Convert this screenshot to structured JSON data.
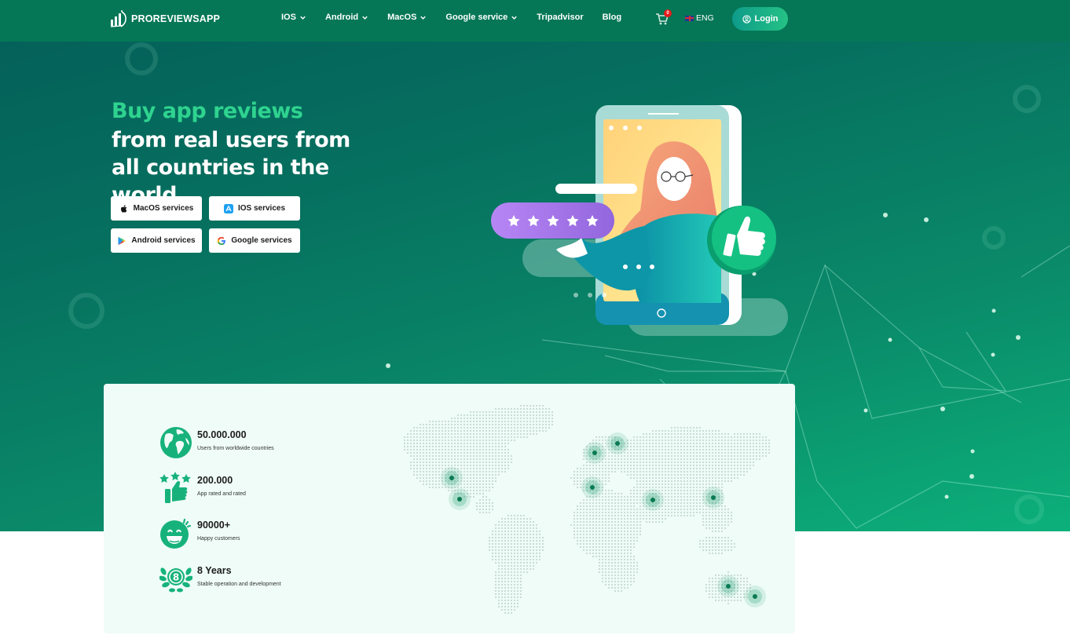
{
  "header": {
    "logo_text": "PROREVIEWSAPP",
    "nav": [
      {
        "label": "IOS",
        "has_dropdown": true
      },
      {
        "label": "Android",
        "has_dropdown": true
      },
      {
        "label": "MacOS",
        "has_dropdown": true
      },
      {
        "label": "Google service",
        "has_dropdown": true
      },
      {
        "label": "Tripadvisor",
        "has_dropdown": false
      },
      {
        "label": "Blog",
        "has_dropdown": false
      }
    ],
    "cart_count": "0",
    "language": "ENG",
    "login_label": "Login"
  },
  "hero": {
    "title_highlight": "Buy app reviews",
    "title_rest": "from real users from all countries in the world",
    "services": [
      {
        "label": "MacOS services",
        "icon": "apple-icon"
      },
      {
        "label": "IOS services",
        "icon": "app-store-icon"
      },
      {
        "label": "Android services",
        "icon": "google-play-icon"
      },
      {
        "label": "Google services",
        "icon": "google-icon"
      }
    ],
    "illustration": {
      "rating_stars": 5
    }
  },
  "stats": [
    {
      "value": "50.000.000",
      "label": "Users from worldwide countries",
      "icon": "globe-icon"
    },
    {
      "value": "200.000",
      "label": "App rated and rated",
      "icon": "stars-thumbs-up-icon"
    },
    {
      "value": "90000+",
      "label": "Happy customers",
      "icon": "happy-face-icon"
    },
    {
      "value": "8 Years",
      "label": "Stable operation and development",
      "icon": "laurel-eight-icon"
    }
  ],
  "colors": {
    "header_bg": "#057756",
    "accent_green": "#2ed38f",
    "stats_bg": "#effcf8",
    "icon_green": "#17b27c",
    "badge_red": "#e51a1a",
    "map_marker": "#0a7a55"
  }
}
